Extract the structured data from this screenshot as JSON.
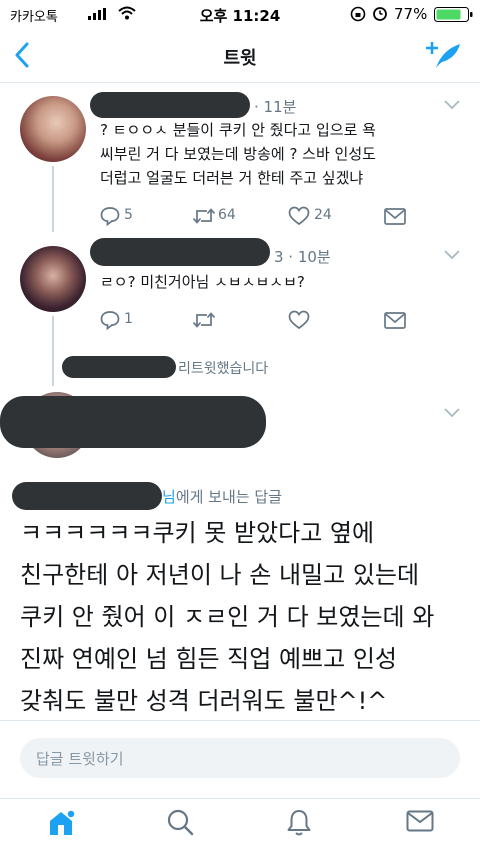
{
  "status_bar": {
    "carrier": "카카오톡",
    "time": "오후 11:24",
    "battery": "77%"
  },
  "nav": {
    "title": "트윗"
  },
  "tweets": [
    {
      "time": "· 11분",
      "text_lines": [
        "? ㅌㅇㅇㅅ 분들이 쿠키 안 줬다고 입으로 욕",
        "씨부린 거 다 보였는데 방송에 ? 스바 인성도",
        "더럽고 얼굴도 더러븐 거 한테 주고 싶겠냐"
      ],
      "replies": "5",
      "retweets": "64",
      "likes": "24"
    },
    {
      "time": "3 · 10분",
      "text_lines": [
        "ㄹㅇ? 미친거아님 ㅅㅂㅅㅂㅅㅂ?"
      ],
      "replies": "1",
      "retweets": "",
      "likes": ""
    }
  ],
  "retweeted_label": "리트윗했습니다",
  "reply_header": {
    "name_fragment": "님",
    "label": "에게 보내는 답글"
  },
  "main_reply_lines": [
    "ㅋㅋㅋㅋㅋㅋ쿠키 못 받았다고 옆에",
    "친구한테 아 저년이 나 손 내밀고 있는데",
    "쿠키 안 줬어 이 ㅈㄹ인 거 다 보였는데 와",
    "진짜 연예인 넘 힘든 직업 예쁘고 인성",
    "갖춰도 불만 성격 더러워도 불만^!^"
  ],
  "compose": {
    "placeholder": "답글 트윗하기"
  },
  "colors": {
    "accent": "#1da1f2",
    "battery": "#4cd964",
    "muted": "#657786"
  }
}
